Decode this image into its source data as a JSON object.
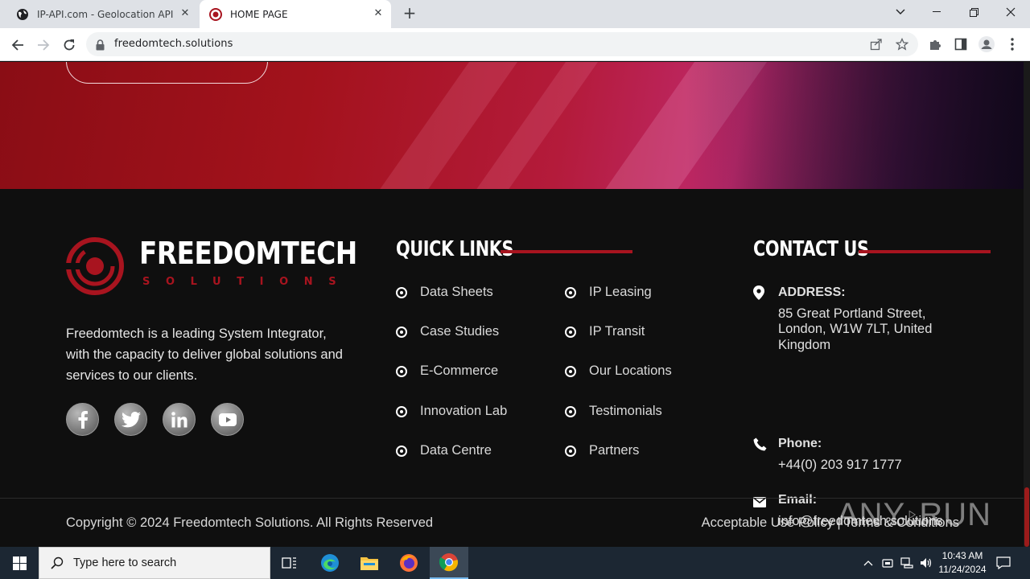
{
  "browser": {
    "tabs": [
      {
        "title": "IP-API.com - Geolocation API",
        "active": false
      },
      {
        "title": "HOME PAGE",
        "active": true
      }
    ],
    "url": "freedomtech.solutions"
  },
  "footer": {
    "brand": {
      "name": "FREEDOMTECH",
      "tagline": "SOLUTIONS"
    },
    "about": "Freedomtech is a leading System Integrator, with the capacity to deliver global solutions and services to our clients.",
    "social": [
      {
        "name": "facebook-icon",
        "glyph": "f"
      },
      {
        "name": "twitter-icon",
        "glyph": "twitter"
      },
      {
        "name": "linkedin-icon",
        "glyph": "in"
      },
      {
        "name": "youtube-icon",
        "glyph": "youtube"
      }
    ],
    "quick_links": {
      "title": "QUICK LINKS",
      "col1": [
        "Data Sheets",
        "Case Studies",
        "E-Commerce",
        "Innovation Lab",
        "Data Centre"
      ],
      "col2": [
        "IP Leasing",
        "IP Transit",
        "Our Locations",
        "Testimonials",
        "Partners"
      ]
    },
    "contact": {
      "title": "CONTACT US",
      "address_label": "ADDRESS:",
      "address_line1": "85 Great Portland Street,",
      "address_line2": "London, W1W 7LT, United",
      "address_line3": "Kingdom",
      "phone_label": "Phone:",
      "phone": "+44(0) 203 917 1777",
      "email_label": "Email:",
      "email": "info@freedomtech.solutions"
    },
    "copyright": "Copyright © 2024 Freedomtech Solutions. All Rights Reserved",
    "legal": {
      "aup": "Acceptable Use Policy",
      "separator": "|",
      "terms": "Terms & Conditions"
    }
  },
  "watermark": {
    "left": "ANY",
    "right": "RUN"
  },
  "taskbar": {
    "search_placeholder": "Type here to search",
    "time": "10:43 AM",
    "date": "11/24/2024"
  },
  "colors": {
    "accent": "#a8141f",
    "footer_bg": "#0f0f0f"
  }
}
